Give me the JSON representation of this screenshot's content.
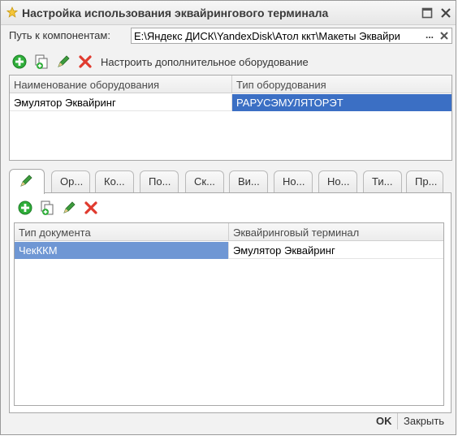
{
  "window": {
    "title": "Настройка использования эквайрингового терминала"
  },
  "path": {
    "label": "Путь к компонентам:",
    "value": "E:\\Яндекс ДИСК\\YandexDisk\\Атол ккт\\Макеты Эквайри",
    "browse_label": "..."
  },
  "toolbar1": {
    "configure_label": "Настроить дополнительное оборудование"
  },
  "equipment_table": {
    "columns": [
      "Наименование оборудования",
      "Тип оборудования"
    ],
    "rows": [
      [
        "Эмулятор Эквайринг",
        "РАРУСЭМУЛЯТОРЭТ"
      ]
    ]
  },
  "tabs": [
    "Ор...",
    "Ко...",
    "По...",
    "Ск...",
    "Ви...",
    "Но...",
    "Но...",
    "Ти...",
    "Пр..."
  ],
  "documents_table": {
    "columns": [
      "Тип документа",
      "Эквайринговый терминал"
    ],
    "rows": [
      [
        "ЧекККМ",
        "Эмулятор Эквайринг"
      ]
    ]
  },
  "footer": {
    "ok_label": "OK",
    "close_label": "Закрыть"
  },
  "colors": {
    "selection": "#3b6fc4",
    "selection_light": "#6f97d4",
    "add_green": "#2fae3a",
    "delete_red": "#e03a2e"
  }
}
